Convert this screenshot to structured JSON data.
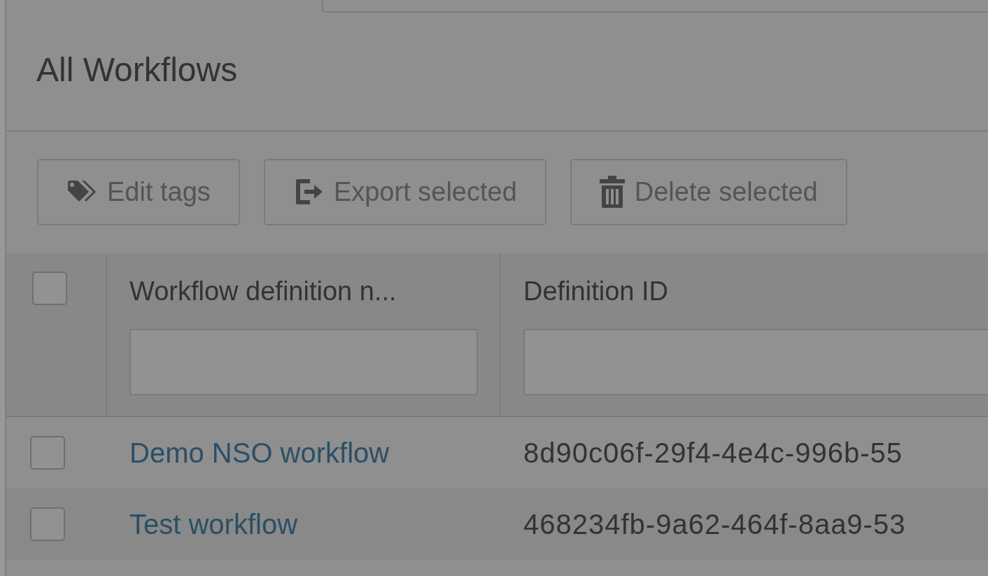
{
  "title": "All Workflows",
  "toolbar": [
    {
      "kind": "tags",
      "label": "Edit tags"
    },
    {
      "kind": "export",
      "label": "Export selected"
    },
    {
      "kind": "delete",
      "label": "Delete selected"
    }
  ],
  "table": {
    "select_all": {
      "checked": false
    },
    "columns": [
      {
        "label": "Workflow definition n..."
      },
      {
        "label": "Definition ID"
      }
    ],
    "rows": [
      {
        "checked": false,
        "name": "Demo NSO workflow",
        "id": "8d90c06f-29f4-4e4c-996b-55"
      },
      {
        "checked": false,
        "name": "Test workflow",
        "id": "468234fb-9a62-464f-8aa9-53"
      }
    ]
  }
}
